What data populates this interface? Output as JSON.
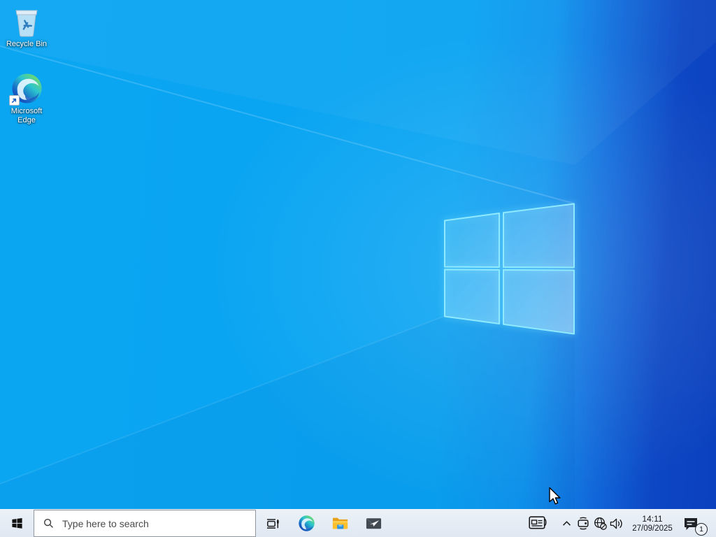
{
  "desktop": {
    "icons": [
      {
        "id": "recycle-bin",
        "label": "Recycle Bin"
      },
      {
        "id": "microsoft-edge",
        "label": "Microsoft Edge"
      }
    ]
  },
  "taskbar": {
    "search": {
      "placeholder": "Type here to search",
      "icon": "search-icon"
    },
    "buttons": [
      "start",
      "task-view",
      "edge",
      "file-explorer",
      "mail"
    ],
    "tray_icons": [
      "news",
      "show-hidden-icons-chevron",
      "meet-now-camera",
      "network-globe-offline",
      "volume-speaker"
    ],
    "clock": {
      "time": "14:11",
      "date": "27/09/2025"
    },
    "notification_badge": "1"
  },
  "colors": {
    "wallpaper_azure": "#0ba6f2",
    "wallpaper_deep_blue": "#0c41bf",
    "logo_edge_glow": "#8feaff",
    "taskbar_bg": "#e6edf6",
    "folder_yellow": "#ffc926",
    "explorer_blue": "#2f94e0",
    "edge_green": "#7ede52",
    "edge_blue": "#1b3fae"
  }
}
